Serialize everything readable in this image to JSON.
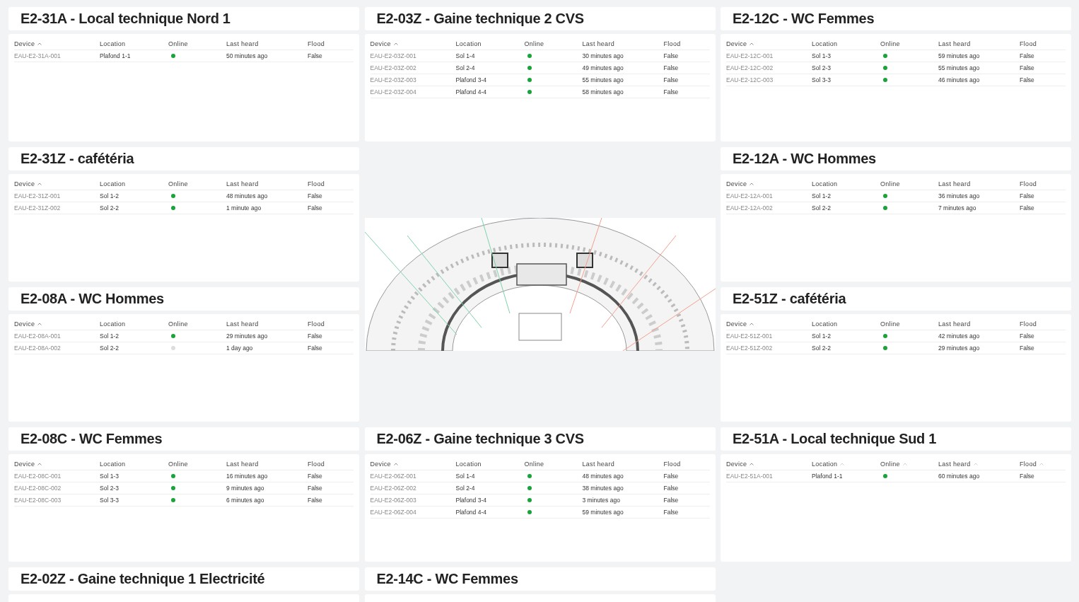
{
  "columns": [
    {
      "items": [
        {
          "kind": "table_card",
          "title": "E2-31A - Local technique Nord 1",
          "columns": [
            {
              "label": "Device",
              "kind": "sorted"
            },
            {
              "label": "Location",
              "kind": "plain"
            },
            {
              "label": "Online",
              "kind": "plain"
            },
            {
              "label": "Last heard",
              "kind": "plain"
            },
            {
              "label": "Flood",
              "kind": "plain"
            }
          ],
          "rows": [
            {
              "device": "EAU-E2-31A-001",
              "location": "Plafond 1-1",
              "online": true,
              "last_heard": "50 minutes ago",
              "flood": "False"
            }
          ]
        },
        {
          "kind": "table_card",
          "title": "E2-31Z - cafétéria",
          "columns": [
            {
              "label": "Device",
              "kind": "sorted"
            },
            {
              "label": "Location",
              "kind": "plain"
            },
            {
              "label": "Online",
              "kind": "plain"
            },
            {
              "label": "Last heard",
              "kind": "plain"
            },
            {
              "label": "Flood",
              "kind": "plain"
            }
          ],
          "rows": [
            {
              "device": "EAU-E2-31Z-001",
              "location": "Sol 1-2",
              "online": true,
              "last_heard": "48 minutes ago",
              "flood": "False"
            },
            {
              "device": "EAU-E2-31Z-002",
              "location": "Sol 2-2",
              "online": true,
              "last_heard": "1 minute ago",
              "flood": "False"
            }
          ]
        },
        {
          "kind": "table_card",
          "title": "E2-08A - WC Hommes",
          "columns": [
            {
              "label": "Device",
              "kind": "sorted"
            },
            {
              "label": "Location",
              "kind": "plain"
            },
            {
              "label": "Online",
              "kind": "plain"
            },
            {
              "label": "Last heard",
              "kind": "plain"
            },
            {
              "label": "Flood",
              "kind": "plain"
            }
          ],
          "rows": [
            {
              "device": "EAU-E2-08A-001",
              "location": "Sol 1-2",
              "online": true,
              "last_heard": "29 minutes ago",
              "flood": "False"
            },
            {
              "device": "EAU-E2-08A-002",
              "location": "Sol 2-2",
              "online": false,
              "last_heard": "1 day ago",
              "flood": "False"
            }
          ]
        },
        {
          "kind": "table_card",
          "title": "E2-08C - WC Femmes",
          "columns": [
            {
              "label": "Device",
              "kind": "sorted"
            },
            {
              "label": "Location",
              "kind": "plain"
            },
            {
              "label": "Online",
              "kind": "plain"
            },
            {
              "label": "Last heard",
              "kind": "plain"
            },
            {
              "label": "Flood",
              "kind": "plain"
            }
          ],
          "rows": [
            {
              "device": "EAU-E2-08C-001",
              "location": "Sol 1-3",
              "online": true,
              "last_heard": "16 minutes ago",
              "flood": "False"
            },
            {
              "device": "EAU-E2-08C-002",
              "location": "Sol 2-3",
              "online": true,
              "last_heard": "9 minutes ago",
              "flood": "False"
            },
            {
              "device": "EAU-E2-08C-003",
              "location": "Sol 3-3",
              "online": true,
              "last_heard": "6 minutes ago",
              "flood": "False"
            }
          ]
        },
        {
          "kind": "table_card",
          "title": "E2-02Z - Gaine technique 1 Electricité"
        }
      ]
    },
    {
      "items": [
        {
          "kind": "table_card",
          "title": "E2-03Z - Gaine technique 2 CVS",
          "columns": [
            {
              "label": "Device",
              "kind": "sorted"
            },
            {
              "label": "Location",
              "kind": "plain"
            },
            {
              "label": "Online",
              "kind": "plain"
            },
            {
              "label": "Last heard",
              "kind": "plain"
            },
            {
              "label": "Flood",
              "kind": "plain"
            }
          ],
          "rows": [
            {
              "device": "EAU-E2-03Z-001",
              "location": "Sol 1-4",
              "online": true,
              "last_heard": "30 minutes ago",
              "flood": "False"
            },
            {
              "device": "EAU-E2-03Z-002",
              "location": "Sol 2-4",
              "online": true,
              "last_heard": "49 minutes ago",
              "flood": "False"
            },
            {
              "device": "EAU-E2-03Z-003",
              "location": "Plafond 3-4",
              "online": true,
              "last_heard": "55 minutes ago",
              "flood": "False"
            },
            {
              "device": "EAU-E2-03Z-004",
              "location": "Plafond 4-4",
              "online": true,
              "last_heard": "58 minutes ago",
              "flood": "False"
            }
          ]
        },
        {
          "kind": "picture"
        },
        {
          "kind": "table_card",
          "title": "E2-06Z - Gaine technique 3 CVS",
          "columns": [
            {
              "label": "Device",
              "kind": "sorted"
            },
            {
              "label": "Location",
              "kind": "plain"
            },
            {
              "label": "Online",
              "kind": "plain"
            },
            {
              "label": "Last heard",
              "kind": "plain"
            },
            {
              "label": "Flood",
              "kind": "plain"
            }
          ],
          "rows": [
            {
              "device": "EAU-E2-06Z-001",
              "location": "Sol 1-4",
              "online": true,
              "last_heard": "48 minutes ago",
              "flood": "False"
            },
            {
              "device": "EAU-E2-06Z-002",
              "location": "Sol 2-4",
              "online": true,
              "last_heard": "38 minutes ago",
              "flood": "False"
            },
            {
              "device": "EAU-E2-06Z-003",
              "location": "Plafond 3-4",
              "online": true,
              "last_heard": "3 minutes ago",
              "flood": "False"
            },
            {
              "device": "EAU-E2-06Z-004",
              "location": "Plafond 4-4",
              "online": true,
              "last_heard": "59 minutes ago",
              "flood": "False"
            }
          ]
        },
        {
          "kind": "table_card",
          "title": "E2-14C - WC Femmes"
        }
      ]
    },
    {
      "items": [
        {
          "kind": "table_card",
          "title": "E2-12C - WC Femmes",
          "columns": [
            {
              "label": "Device",
              "kind": "sorted"
            },
            {
              "label": "Location",
              "kind": "plain"
            },
            {
              "label": "Online",
              "kind": "plain"
            },
            {
              "label": "Last heard",
              "kind": "plain"
            },
            {
              "label": "Flood",
              "kind": "plain"
            }
          ],
          "rows": [
            {
              "device": "EAU-E2-12C-001",
              "location": "Sol 1-3",
              "online": true,
              "last_heard": "59 minutes ago",
              "flood": "False"
            },
            {
              "device": "EAU-E2-12C-002",
              "location": "Sol 2-3",
              "online": true,
              "last_heard": "55 minutes ago",
              "flood": "False"
            },
            {
              "device": "EAU-E2-12C-003",
              "location": "Sol 3-3",
              "online": true,
              "last_heard": "46 minutes ago",
              "flood": "False"
            }
          ]
        },
        {
          "kind": "table_card",
          "title": "E2-12A - WC Hommes",
          "columns": [
            {
              "label": "Device",
              "kind": "sorted"
            },
            {
              "label": "Location",
              "kind": "plain"
            },
            {
              "label": "Online",
              "kind": "plain"
            },
            {
              "label": "Last heard",
              "kind": "plain"
            },
            {
              "label": "Flood",
              "kind": "plain"
            }
          ],
          "rows": [
            {
              "device": "EAU-E2-12A-001",
              "location": "Sol 1-2",
              "online": true,
              "last_heard": "36 minutes ago",
              "flood": "False"
            },
            {
              "device": "EAU-E2-12A-002",
              "location": "Sol 2-2",
              "online": true,
              "last_heard": "7 minutes ago",
              "flood": "False"
            }
          ]
        },
        {
          "kind": "table_card",
          "title": "E2-51Z - cafétéria",
          "columns": [
            {
              "label": "Device",
              "kind": "sorted"
            },
            {
              "label": "Location",
              "kind": "plain"
            },
            {
              "label": "Online",
              "kind": "plain"
            },
            {
              "label": "Last heard",
              "kind": "plain"
            },
            {
              "label": "Flood",
              "kind": "plain"
            }
          ],
          "rows": [
            {
              "device": "EAU-E2-51Z-001",
              "location": "Sol 1-2",
              "online": true,
              "last_heard": "42 minutes ago",
              "flood": "False"
            },
            {
              "device": "EAU-E2-51Z-002",
              "location": "Sol 2-2",
              "online": true,
              "last_heard": "29 minutes ago",
              "flood": "False"
            }
          ]
        },
        {
          "kind": "table_card",
          "title": "E2-51A - Local technique Sud 1",
          "columns": [
            {
              "label": "Device",
              "kind": "sorted"
            },
            {
              "label": "Location",
              "kind": "sortable"
            },
            {
              "label": "Online",
              "kind": "sortable"
            },
            {
              "label": "Last heard",
              "kind": "sortable"
            },
            {
              "label": "Flood",
              "kind": "sortable"
            }
          ],
          "rows": [
            {
              "device": "EAU-E2-51A-001",
              "location": "Plafond 1-1",
              "online": true,
              "last_heard": "60 minutes ago",
              "flood": "False"
            }
          ]
        }
      ]
    }
  ]
}
